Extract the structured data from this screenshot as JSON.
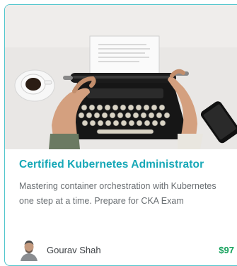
{
  "course_card": {
    "title": "Certified Kubernetes Administrator",
    "description": "Mastering container orchestration with Kubernetes one step at a time. Prepare for CKA Exam",
    "author": "Gourav Shah",
    "price": "$97",
    "image_icon": "typewriter-photo",
    "author_icon": "author-avatar",
    "colors": {
      "accent": "#4fc5cc",
      "title": "#17a8b7",
      "price": "#12a05a"
    }
  }
}
